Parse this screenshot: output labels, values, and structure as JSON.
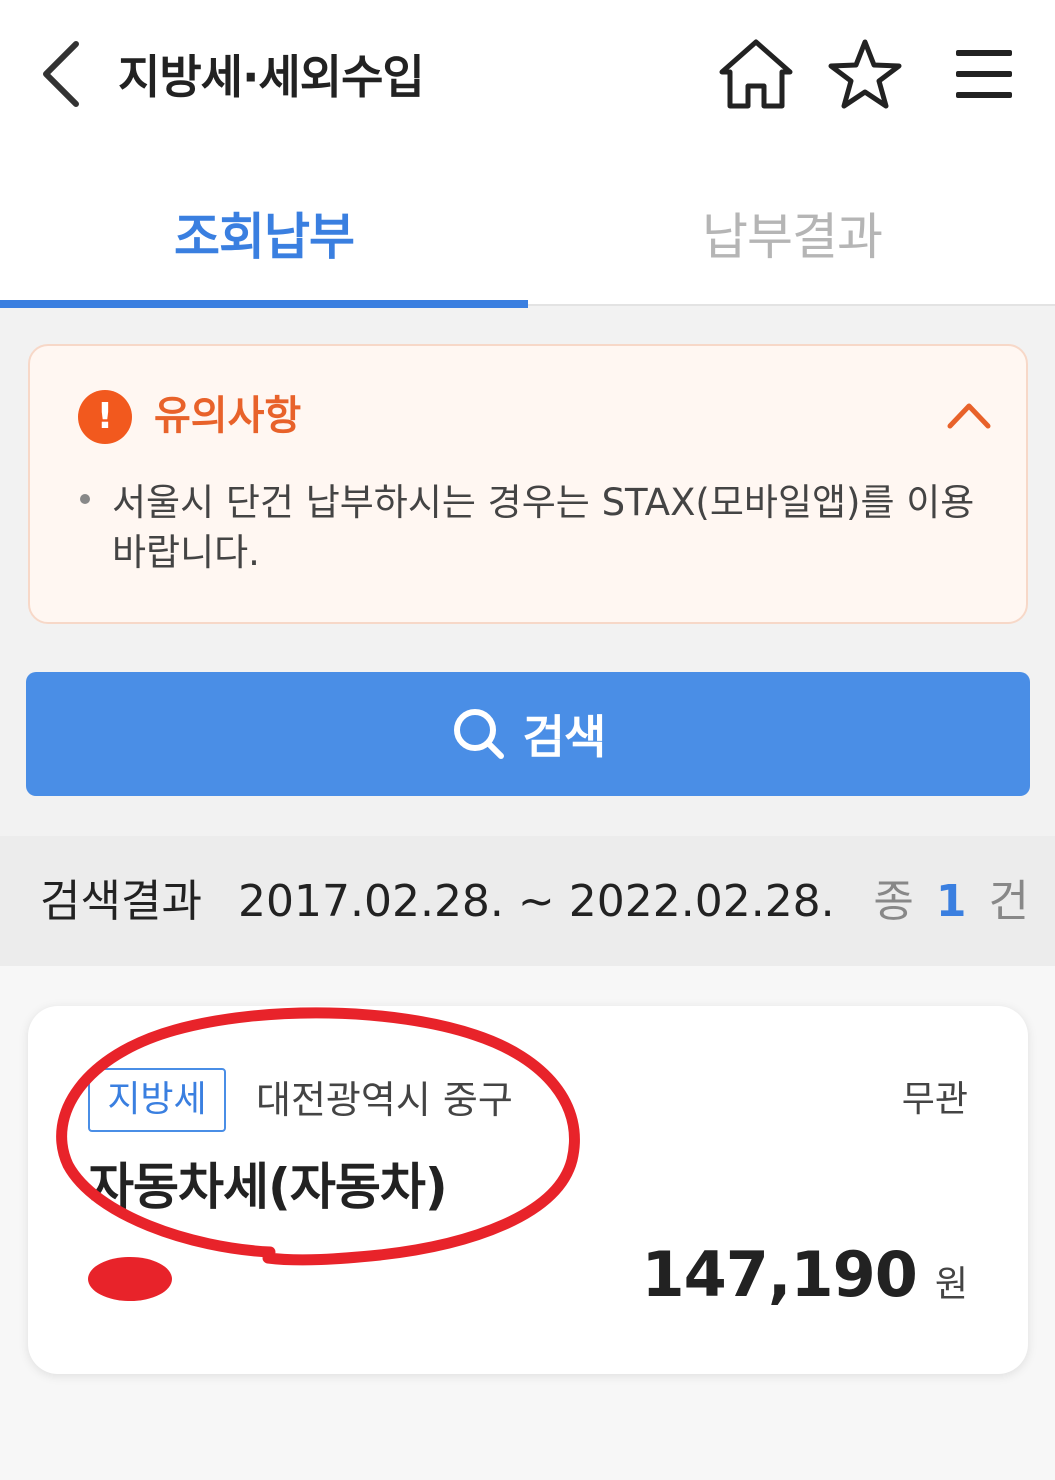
{
  "header": {
    "title": "지방세·세외수입",
    "icons": [
      "chevron-left-icon",
      "home-icon",
      "star-icon",
      "menu-icon"
    ]
  },
  "tabs": [
    {
      "label": "조회납부",
      "active": true
    },
    {
      "label": "납부결과",
      "active": false
    }
  ],
  "notice": {
    "title": "유의사항",
    "expanded": true,
    "text": "서울시 단건 납부하시는 경우는 STAX(모바일앱)를 이용바랍니다."
  },
  "search": {
    "button_label": "검색"
  },
  "results": {
    "label": "검색결과",
    "range": "2017.02.28. ~ 2022.02.28.",
    "count_prefix": "종",
    "count": "1",
    "count_suffix": "건"
  },
  "items": [
    {
      "badge": "지방세",
      "region": "대전광역시 중구",
      "status": "무관",
      "name": "자동차세(자동차)",
      "amount": "147,190",
      "currency": "원"
    }
  ],
  "colors": {
    "accent": "#3a7fe0",
    "button": "#4a8ee6",
    "notice_accent": "#e8622a",
    "annotation": "#e8232a"
  }
}
